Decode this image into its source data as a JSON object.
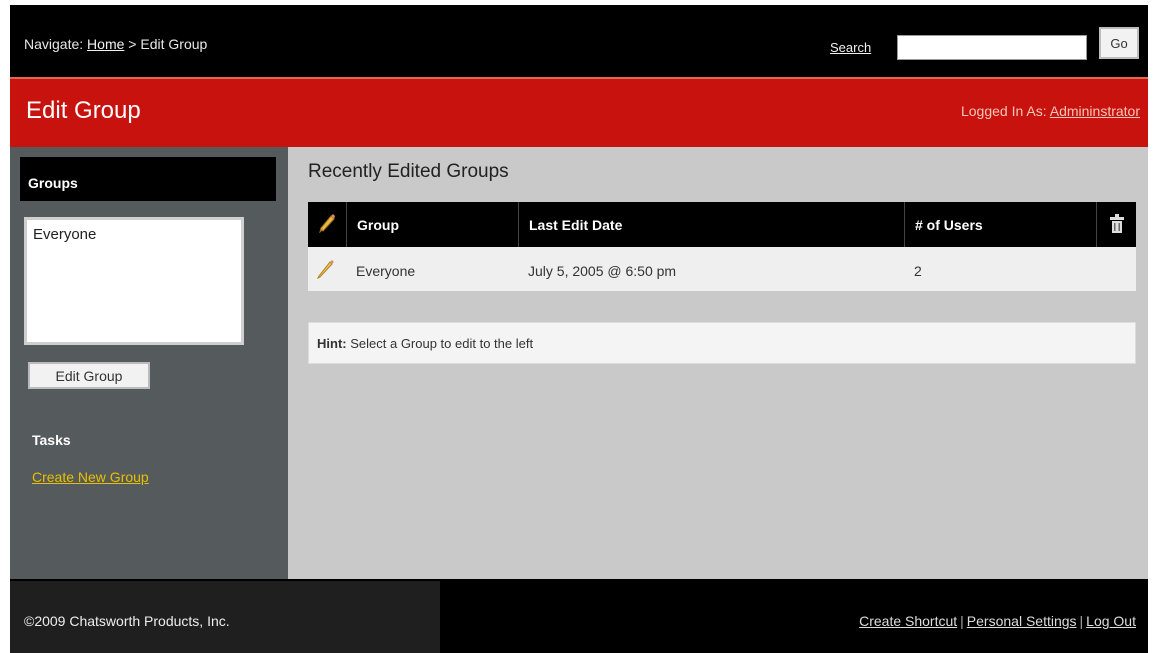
{
  "nav": {
    "prefix": "Navigate:",
    "home": "Home",
    "separator": ">",
    "current": "Edit Group",
    "search_label": "Search",
    "search_value": "",
    "go_label": "Go"
  },
  "header": {
    "title": "Edit Group",
    "logged_in_prefix": "Logged In As:",
    "user": "Admininstrator"
  },
  "sidebar": {
    "groups_title": "Groups",
    "group_items": [
      "Everyone"
    ],
    "edit_button": "Edit Group",
    "tasks_title": "Tasks",
    "create_link": "Create New Group"
  },
  "main": {
    "title": "Recently Edited Groups",
    "columns": [
      "Group",
      "Last Edit Date",
      "# of Users"
    ],
    "rows": [
      {
        "group": "Everyone",
        "date": "July 5, 2005 @ 6:50 pm",
        "users": "2"
      }
    ],
    "hint_label": "Hint:",
    "hint_text": "Select a Group to edit to the left"
  },
  "footer": {
    "copyright": "©2009 Chatsworth Products, Inc.",
    "links": [
      "Create Shortcut",
      "Personal Settings",
      "Log Out"
    ]
  },
  "colors": {
    "title_bar": "#c8120e",
    "sidebar": "#555a5c",
    "content": "#c9c9c9",
    "task_link": "#e8c000"
  },
  "icons": [
    "pencil-icon",
    "trash-icon"
  ]
}
